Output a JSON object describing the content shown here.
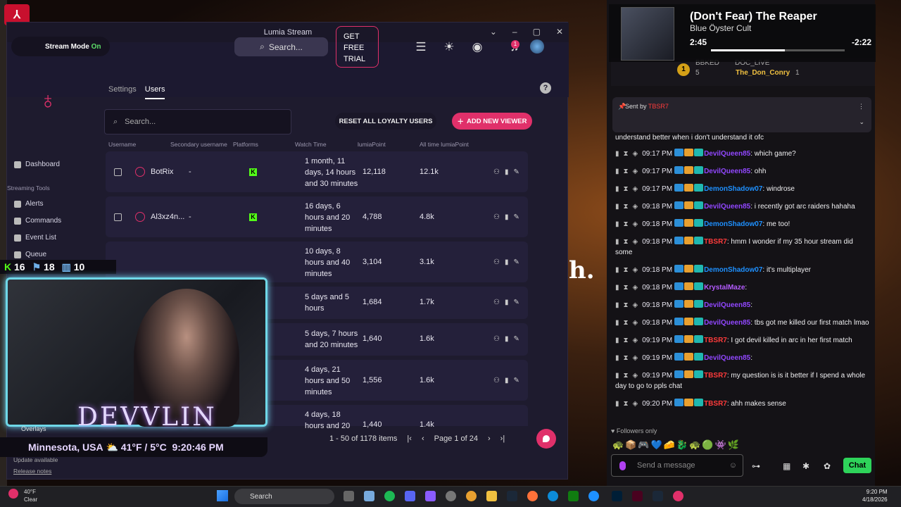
{
  "lumia": {
    "window_title": "Lumia Stream",
    "stream_mode_label": "Stream Mode",
    "stream_mode_state": "On",
    "search_placeholder": "Search...",
    "trial_lines": [
      "GET",
      "FREE",
      "TRIAL"
    ],
    "notification_count": "1",
    "tabs": [
      "Settings",
      "Users"
    ],
    "sidebar": {
      "dashboard": "Dashboard",
      "section": "Streaming Tools",
      "items": [
        "Alerts",
        "Commands",
        "Event List",
        "Queue"
      ],
      "overlays": "Overlays",
      "update": "Update available",
      "release_notes": "Release notes"
    },
    "user_search_placeholder": "Search...",
    "reset_label": "RESET ALL LOYALTY USERS",
    "add_label": "ADD NEW VIEWER",
    "columns": [
      "Username",
      "Secondary username",
      "Platforms",
      "Watch Time",
      "lumiaPoint",
      "All time lumiaPoint"
    ],
    "rows": [
      {
        "username": "BotRix",
        "secondary": "-",
        "watch": [
          "1 month, 11",
          "days, 14 hours",
          "and 30 minutes"
        ],
        "points": "12,118",
        "alltime": "12.1k"
      },
      {
        "username": "Al3xz4n...",
        "secondary": "-",
        "watch": [
          "16 days, 6",
          "hours and 20",
          "minutes"
        ],
        "points": "4,788",
        "alltime": "4.8k"
      },
      {
        "username": "",
        "secondary": "",
        "watch": [
          "10 days, 8",
          "hours and 40",
          "minutes"
        ],
        "points": "3,104",
        "alltime": "3.1k"
      },
      {
        "username": "",
        "secondary": "",
        "watch": [
          "5 days and 5",
          "hours"
        ],
        "points": "1,684",
        "alltime": "1.7k"
      },
      {
        "username": "",
        "secondary": "",
        "watch": [
          "5 days, 7 hours",
          "and 20 minutes"
        ],
        "points": "1,640",
        "alltime": "1.6k"
      },
      {
        "username": "",
        "secondary": "",
        "watch": [
          "4 days, 21",
          "hours and 50",
          "minutes"
        ],
        "points": "1,556",
        "alltime": "1.6k"
      },
      {
        "username": "",
        "secondary": "",
        "watch": [
          "4 days, 18",
          "hours and 20"
        ],
        "points": "1,440",
        "alltime": "1.4k"
      }
    ],
    "pagination": {
      "range": "1 - 50 of 1178 items",
      "page": "Page 1 of 24"
    }
  },
  "overlay": {
    "stats": [
      "16",
      "18",
      "10"
    ],
    "name": "DEVVLIN",
    "location": "Minnesota, USA",
    "temp": "41°F / 5°C",
    "time": "9:20:46 PM",
    "backdrop_text": "h."
  },
  "music": {
    "title": "(Don't Fear) The Reaper",
    "artist": "Blue Öyster Cult",
    "elapsed": "2:45",
    "remaining": "-2:22",
    "progress": 0.55
  },
  "chat": {
    "top_users": [
      {
        "rank": "1",
        "name": "BBKED",
        "extra": "DOC_LIVE",
        "count": "5"
      },
      {
        "rank": "",
        "name": "The_Don_Conry",
        "count": "1"
      }
    ],
    "pinned": {
      "label": "Sent by",
      "user": "TBSR7"
    },
    "partial_line": "understand better when i don't understand it ofc",
    "messages": [
      {
        "time": "09:17 PM",
        "user": "DevilQueen85",
        "color": "#9147ff",
        "text": ": which game?"
      },
      {
        "time": "09:17 PM",
        "user": "DevilQueen85",
        "color": "#9147ff",
        "text": ": ohh"
      },
      {
        "time": "09:17 PM",
        "user": "DemonShadow07",
        "color": "#1e90ff",
        "text": ": windrose"
      },
      {
        "time": "09:18 PM",
        "user": "DevilQueen85",
        "color": "#9147ff",
        "text": ": i recently got arc raiders hahaha"
      },
      {
        "time": "09:18 PM",
        "user": "DemonShadow07",
        "color": "#1e90ff",
        "text": ": me too!"
      },
      {
        "time": "09:18 PM",
        "user": "TBSR7",
        "color": "#ff3b3b",
        "text": ": hmm I wonder if my 35 hour stream did some"
      },
      {
        "time": "09:18 PM",
        "user": "DemonShadow07",
        "color": "#1e90ff",
        "text": ": it's multiplayer"
      },
      {
        "time": "09:18 PM",
        "user": "KrystalMaze",
        "color": "#b45cff",
        "text": ":"
      },
      {
        "time": "09:18 PM",
        "user": "DevilQueen85",
        "color": "#9147ff",
        "text": ":"
      },
      {
        "time": "09:18 PM",
        "user": "DevilQueen85",
        "color": "#9147ff",
        "text": ": tbs got me killed our first match lmao"
      },
      {
        "time": "09:19 PM",
        "user": "TBSR7",
        "color": "#ff3b3b",
        "text": ": I got devil killed in arc in her first match"
      },
      {
        "time": "09:19 PM",
        "user": "DevilQueen85",
        "color": "#9147ff",
        "text": ":"
      },
      {
        "time": "09:19 PM",
        "user": "TBSR7",
        "color": "#ff3b3b",
        "text": ": my question is is it better if I spend a whole day to go to ppls chat"
      },
      {
        "time": "09:20 PM",
        "user": "TBSR7",
        "color": "#ff3b3b",
        "text": ": ahh makes sense"
      }
    ],
    "followers_only": "Followers only",
    "input_placeholder": "Send a message",
    "send_label": "Chat"
  },
  "taskbar": {
    "weather_temp": "40°F",
    "weather_desc": "Clear",
    "search_label": "Search",
    "time": "9:20 PM",
    "date": "4/18/2026"
  }
}
